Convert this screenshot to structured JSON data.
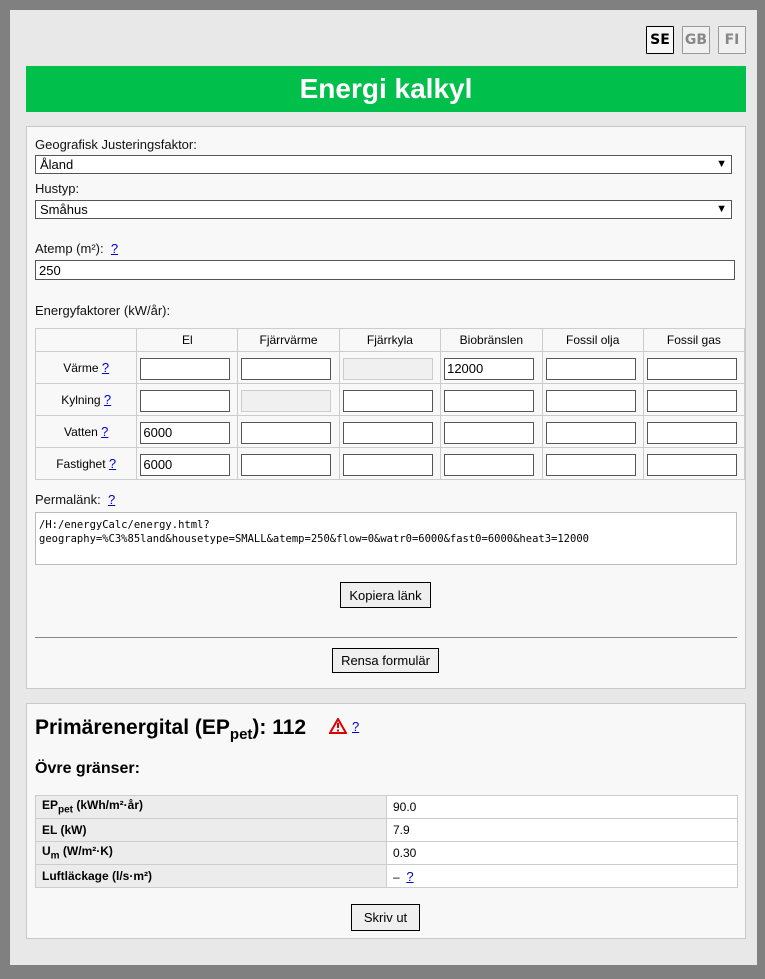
{
  "languages": [
    {
      "code": "SE",
      "active": true
    },
    {
      "code": "GB",
      "active": false
    },
    {
      "code": "FI",
      "active": false
    }
  ],
  "title": "Energi kalkyl",
  "brand_color": "#00c04b",
  "form": {
    "geo_label": "Geografisk Justeringsfaktor:",
    "geo_value": "Åland",
    "house_label": "Hustyp:",
    "house_value": "Småhus",
    "atemp_label": "Atemp (m²):",
    "atemp_value": "250",
    "help": "?",
    "energy_label": "Energyfaktorer (kW/år):",
    "columns": [
      "El",
      "Fjärrvärme",
      "Fjärrkyla",
      "Biobränslen",
      "Fossil olja",
      "Fossil gas"
    ],
    "rows": [
      {
        "label": "Värme",
        "values": [
          "",
          "",
          "",
          "12000",
          "",
          ""
        ],
        "disabled": [
          false,
          false,
          true,
          false,
          false,
          false
        ]
      },
      {
        "label": "Kylning",
        "values": [
          "",
          "",
          "",
          "",
          "",
          ""
        ],
        "disabled": [
          false,
          true,
          false,
          false,
          false,
          false
        ]
      },
      {
        "label": "Vatten",
        "values": [
          "6000",
          "",
          "",
          "",
          "",
          ""
        ],
        "disabled": [
          false,
          false,
          false,
          false,
          false,
          false
        ]
      },
      {
        "label": "Fastighet",
        "values": [
          "6000",
          "",
          "",
          "",
          "",
          ""
        ],
        "disabled": [
          false,
          false,
          false,
          false,
          false,
          false
        ]
      }
    ],
    "permalink_label": "Permalänk:",
    "permalink_value": "/H:/energyCalc/energy.html?\ngeography=%C3%85land&housetype=SMALL&atemp=250&flow=0&watr0=6000&fast0=6000&heat3=12000",
    "copy_button": "Kopiera länk",
    "clear_button": "Rensa formulär"
  },
  "result": {
    "ep_prefix": "Primärenergital (EP",
    "ep_sub": "pet",
    "ep_suffix": "): 112",
    "help": "?",
    "limits_heading": "Övre gränser:",
    "limits": [
      {
        "key": "EP",
        "sub": "pet",
        "unit": " (kWh/m²·år)",
        "value": "90.0"
      },
      {
        "key": "EL",
        "sub": "",
        "unit": " (kW)",
        "value": "7.9"
      },
      {
        "key": "U",
        "sub": "m",
        "unit": " (W/m²·K)",
        "value": "0.30"
      },
      {
        "key": "Luftläckage",
        "sub": "",
        "unit": " (l/s·m²)",
        "value": "–"
      }
    ],
    "print_button": "Skriv ut"
  }
}
